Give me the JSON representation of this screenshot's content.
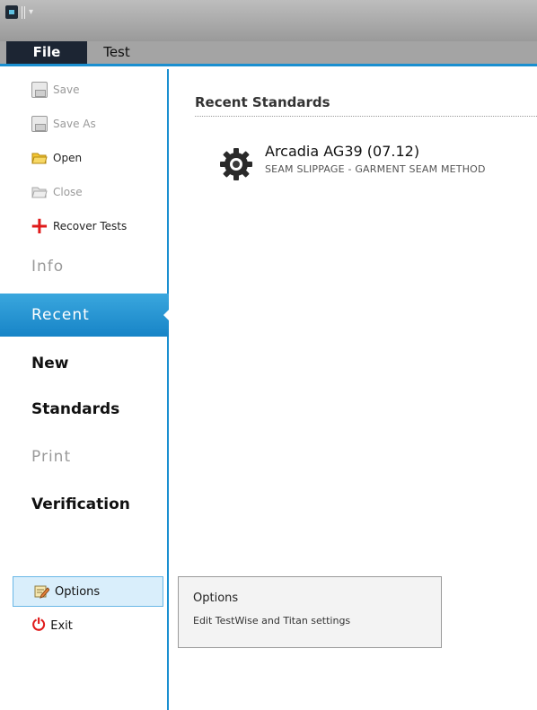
{
  "ribbon": {
    "tabs": [
      {
        "label": "File"
      },
      {
        "label": "Test"
      }
    ]
  },
  "sidebar": {
    "commands": [
      {
        "label": "Save",
        "icon": "save-icon",
        "disabled": true
      },
      {
        "label": "Save As",
        "icon": "save-as-icon",
        "disabled": true
      },
      {
        "label": "Open",
        "icon": "folder-open-icon",
        "disabled": false
      },
      {
        "label": "Close",
        "icon": "folder-close-icon",
        "disabled": true
      },
      {
        "label": "Recover Tests",
        "icon": "plus-icon",
        "disabled": false
      }
    ],
    "nav": [
      {
        "label": "Info",
        "state": "disabled"
      },
      {
        "label": "Recent",
        "state": "active"
      },
      {
        "label": "New",
        "state": "normal"
      },
      {
        "label": "Standards",
        "state": "normal"
      },
      {
        "label": "Print",
        "state": "disabled"
      },
      {
        "label": "Verification",
        "state": "normal"
      }
    ],
    "options_label": "Options",
    "exit_label": "Exit"
  },
  "main": {
    "section_title": "Recent Standards",
    "recent_items": [
      {
        "title": "Arcadia AG39 (07.12)",
        "subtitle": "SEAM SLIPPAGE - GARMENT SEAM METHOD",
        "icon": "gear-icon"
      }
    ]
  },
  "tooltip": {
    "title": "Options",
    "description": "Edit TestWise and Titan settings"
  },
  "colors": {
    "accent": "#1a8fd0",
    "file_tab": "#1c2533",
    "danger": "#e01b1b"
  }
}
